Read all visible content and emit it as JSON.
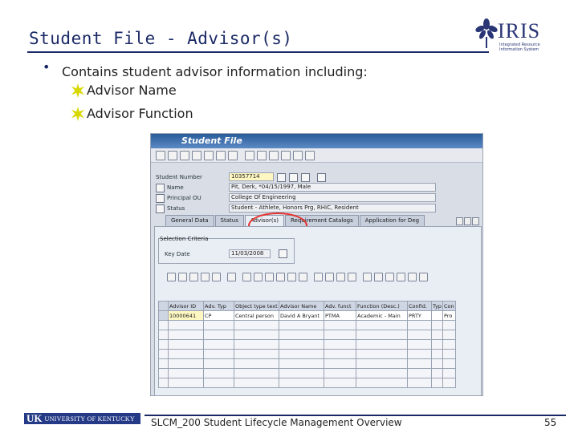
{
  "slide": {
    "title": "Student File - Advisor(s)",
    "bullet_symbol": "•",
    "bullet": "Contains student advisor information including:",
    "sub_items": [
      "Advisor Name",
      "Advisor Function"
    ],
    "footer": "SLCM_200 Student Lifecycle Management Overview",
    "page_number": "55",
    "logo_word": "IRIS",
    "logo_tagline": "Integrated Resource Information System",
    "uk_mark": "UK",
    "uk_name": "UNIVERSITY OF KENTUCKY",
    "colors": {
      "title": "#1b2a66",
      "sap_header": "#2a5c9b",
      "highlight_circle": "#e5312b",
      "star": "#d8d800"
    }
  },
  "sap": {
    "window_title": "Student File",
    "student_number_label": "Student Number",
    "student_number_value": "10357714",
    "name_label": "Name",
    "name_value": "Pit, Derk, *04/15/1997, Male",
    "principal_ou_label": "Principal OU",
    "principal_ou_value": "College Of Engineering",
    "status_label": "Status",
    "status_value": "Student - Athlete, Honors Prg, RHIC, Resident",
    "tabs": [
      "General Data",
      "Status",
      "Advisor(s)",
      "Requirement Catalogs",
      "Application for Deg"
    ],
    "active_tab": "Advisor(s)",
    "selection_criteria_title": "Selection Criteria",
    "key_date_label": "Key Date",
    "key_date_value": "11/03/2008",
    "table_headers": [
      "Advisor ID",
      "Adv. Typ",
      "Object type text",
      "Advisor Name",
      "Adv. funct",
      "Function (Desc.)",
      "Confid.",
      "Typ",
      "Con"
    ],
    "table_rows": [
      [
        "10000641",
        "CP",
        "Central person",
        "David A Bryant",
        "PTMA",
        "Academic - Main",
        "PRTY",
        "",
        "Pro"
      ]
    ]
  }
}
